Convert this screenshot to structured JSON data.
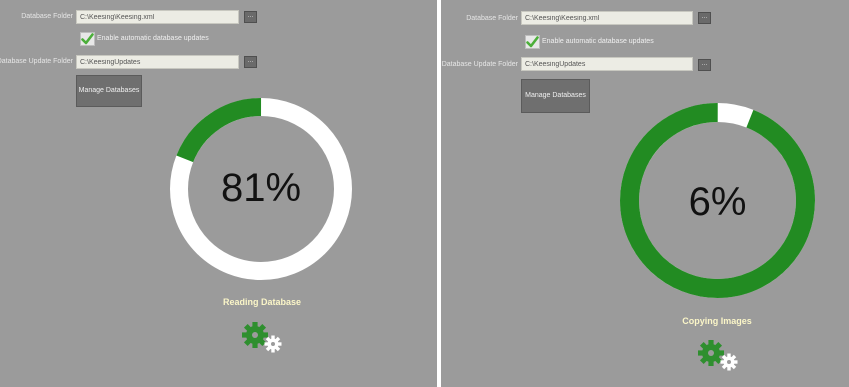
{
  "screens": [
    {
      "database_folder_label": "Database Folder",
      "database_folder_value": "C:\\Keesing\\Keesing.xml",
      "browse_label": "...",
      "auto_update_label": "Enable automatic database updates",
      "auto_update_checked": true,
      "update_folder_label": "Database Update Folder",
      "update_folder_value": "C:\\KeesingUpdates",
      "manage_button_label": "Manage Databases",
      "progress_percent": 81,
      "progress_text": "81%",
      "status_text": "Reading Database"
    },
    {
      "database_folder_label": "Database Folder",
      "database_folder_value": "C:\\Keesing\\Keesing.xml",
      "browse_label": "...",
      "auto_update_label": "Enable automatic database updates",
      "auto_update_checked": true,
      "update_folder_label": "Database Update Folder",
      "update_folder_value": "C:\\KeesingUpdates",
      "manage_button_label": "Manage Databases",
      "progress_percent": 6,
      "progress_text": "6%",
      "status_text": "Copying Images"
    }
  ],
  "colors": {
    "background": "#9b9b9b",
    "ring_green": "#228b22",
    "ring_white": "#ffffff",
    "check_green": "#4caf3a",
    "status_text": "#fbf6c8",
    "gear_green": "#2f8f2f",
    "gear_white": "#ffffff"
  },
  "icons": {
    "check": "check-icon",
    "gears": "gears-icon"
  }
}
